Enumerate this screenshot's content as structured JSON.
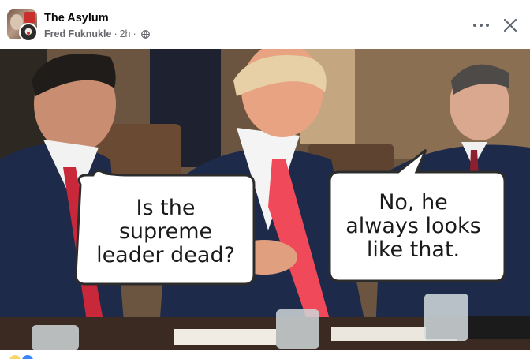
{
  "post": {
    "group_name": "The Asylum",
    "author": "Fred Fuknukle",
    "time": "2h",
    "separator": "·",
    "privacy_icon": "globe-icon"
  },
  "actions": {
    "more_icon": "more-options-icon",
    "close_icon": "close-icon"
  },
  "meme": {
    "left_bubble": "Is the\nsupreme\nleader dead?",
    "right_bubble": "No, he\nalways looks\nlike that.",
    "colors": {
      "left_tie": "#c8283a",
      "center_tie": "#f04a5a",
      "right_tie": "#8e1f2e",
      "suit": "#1d2a4a",
      "wall": "#6b5541"
    }
  },
  "reactions": [
    "like-icon",
    "love-icon"
  ]
}
